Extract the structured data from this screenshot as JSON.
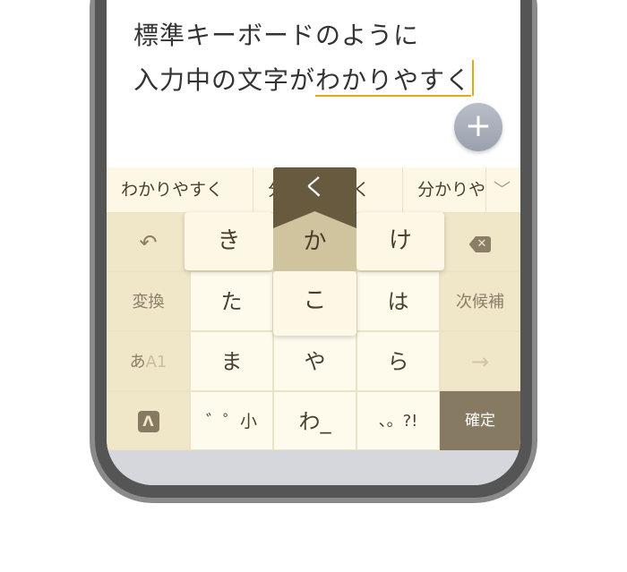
{
  "editor": {
    "line1": "標準キーボードのように",
    "line2_plain": "入力中の文字が",
    "line2_composing": "わかりやすく"
  },
  "fab": {
    "icon": "plus-icon",
    "label": "+"
  },
  "candidates": [
    "わかりやすく",
    "分かりやすく",
    "分かりやすく"
  ],
  "candidates_more_icon": "chevron-down-icon",
  "keys": {
    "undo": "undo-icon",
    "delete": "backspace-icon",
    "ta": "た",
    "ha": "は",
    "convert": "変換",
    "next_candidate": "次候補",
    "mode_a": "あ",
    "mode_b": "A1",
    "ma": "ま",
    "ya": "や",
    "ra": "ら",
    "arrow": "→",
    "app_icon": "keyboard-logo-icon",
    "dakuten": "゛゜小",
    "wa": "わ_",
    "punct": "、。?!",
    "confirm": "確定"
  },
  "flick_popup": {
    "center": "か",
    "left": "き",
    "right": "け",
    "down": "こ",
    "up": "く"
  },
  "colors": {
    "accent": "#e6a817",
    "key_light": "#fefbed",
    "key_fn": "#f0e6c8",
    "confirm": "#877a62",
    "popup_up": "#675a3e",
    "popup_center": "#d0c49f"
  }
}
